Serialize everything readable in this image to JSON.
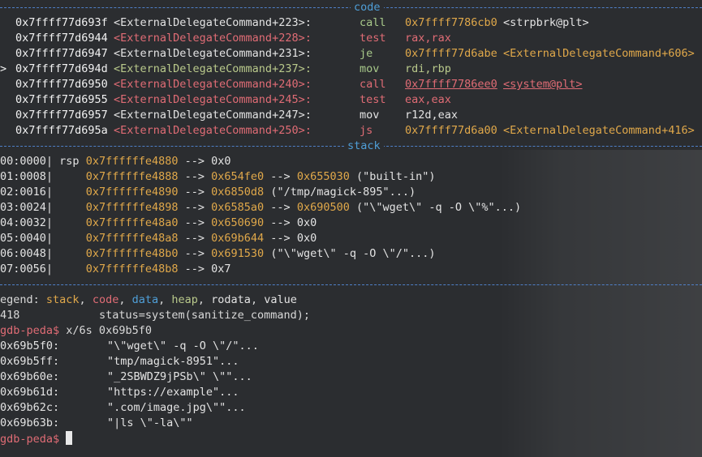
{
  "sections": {
    "code_label": "code",
    "stack_label": "stack"
  },
  "code": [
    {
      "marker": "",
      "addr": "0x7ffff77d693f",
      "sym": "<ExternalDelegateCommand+223>:",
      "mn": "call",
      "op": "0x7ffff7786cb0",
      "tgt": "<strpbrk@plt>",
      "style": "plain"
    },
    {
      "marker": "",
      "addr": "0x7ffff77d6944",
      "sym": "<ExternalDelegateCommand+228>:",
      "mn": "test",
      "op": "rax,rax",
      "tgt": "",
      "style": "hl"
    },
    {
      "marker": "",
      "addr": "0x7ffff77d6947",
      "sym": "<ExternalDelegateCommand+231>:",
      "mn": "je",
      "op": "0x7ffff77d6abe",
      "tgt": "<ExternalDelegateCommand+606>",
      "style": "plain"
    },
    {
      "marker": ">",
      "addr": "0x7ffff77d694d",
      "sym": "<ExternalDelegateCommand+237>:",
      "mn": "mov",
      "op": "rdi,rbp",
      "tgt": "",
      "style": "gr"
    },
    {
      "marker": "",
      "addr": "0x7ffff77d6950",
      "sym": "<ExternalDelegateCommand+240>:",
      "mn": "call",
      "op": "0x7ffff7786ee0",
      "tgt": "<system@plt>",
      "style": "red"
    },
    {
      "marker": "",
      "addr": "0x7ffff77d6955",
      "sym": "<ExternalDelegateCommand+245>:",
      "mn": "test",
      "op": "eax,eax",
      "tgt": "",
      "style": "hl"
    },
    {
      "marker": "",
      "addr": "0x7ffff77d6957",
      "sym": "<ExternalDelegateCommand+247>:",
      "mn": "mov",
      "op": "r12d,eax",
      "tgt": "",
      "style": "wh"
    },
    {
      "marker": "",
      "addr": "0x7ffff77d695a",
      "sym": "<ExternalDelegateCommand+250>:",
      "mn": "js",
      "op": "0x7ffff77d6a00",
      "tgt": "<ExternalDelegateCommand+416>",
      "style": "hl"
    }
  ],
  "stack": [
    {
      "idx": "00:0000|",
      "reg": "rsp",
      "addr": "0x7ffffffe4880",
      "chain": [
        {
          "t": "0x0",
          "y": false
        }
      ],
      "tail": ""
    },
    {
      "idx": "01:0008|",
      "reg": "",
      "addr": "0x7ffffffe4888",
      "chain": [
        {
          "t": "0x654fe0",
          "y": true
        },
        {
          "t": "0x655030",
          "y": true
        }
      ],
      "tail": "(\"built-in\")"
    },
    {
      "idx": "02:0016|",
      "reg": "",
      "addr": "0x7ffffffe4890",
      "chain": [
        {
          "t": "0x6850d8",
          "y": true
        }
      ],
      "tail": "(\"/tmp/magick-895\"...)"
    },
    {
      "idx": "03:0024|",
      "reg": "",
      "addr": "0x7ffffffe4898",
      "chain": [
        {
          "t": "0x6585a0",
          "y": true
        },
        {
          "t": "0x690500",
          "y": true
        }
      ],
      "tail": "(\"\\\"wget\\\" -q -O \\\"%\"...)"
    },
    {
      "idx": "04:0032|",
      "reg": "",
      "addr": "0x7ffffffe48a0",
      "chain": [
        {
          "t": "0x650690",
          "y": true
        },
        {
          "t": "0x0",
          "y": false
        }
      ],
      "tail": ""
    },
    {
      "idx": "05:0040|",
      "reg": "",
      "addr": "0x7ffffffe48a8",
      "chain": [
        {
          "t": "0x69b644",
          "y": true
        },
        {
          "t": "0x0",
          "y": false
        }
      ],
      "tail": ""
    },
    {
      "idx": "06:0048|",
      "reg": "",
      "addr": "0x7ffffffe48b0",
      "chain": [
        {
          "t": "0x691530",
          "y": true
        }
      ],
      "tail": "(\"\\\"wget\\\" -q -O \\\"/\"...)"
    },
    {
      "idx": "07:0056|",
      "reg": "",
      "addr": "0x7ffffffe48b8",
      "chain": [
        {
          "t": "0x7",
          "y": false
        }
      ],
      "tail": ""
    }
  ],
  "legend": {
    "prefix": "egend: ",
    "stack": "stack",
    "code": "code",
    "data": "data",
    "heap": "heap",
    "rodata": "rodata",
    "value": "value"
  },
  "source_line": {
    "num": "418",
    "text": "status=system(sanitize_command);"
  },
  "prompt": "gdb-peda$",
  "command": "x/6s 0x69b5f0",
  "memory": [
    {
      "addr": "0x69b5f0:",
      "str": "\"\\\"wget\\\" -q -O \\\"/\"..."
    },
    {
      "addr": "0x69b5ff:",
      "str": "\"tmp/magick-8951\"..."
    },
    {
      "addr": "0x69b60e:",
      "str": "\"_2SBWDZ9jPSb\\\" \\\"\"..."
    },
    {
      "addr": "0x69b61d:",
      "str": "\"https://example\"..."
    },
    {
      "addr": "0x69b62c:",
      "str": "\".com/image.jpg\\\"\"..."
    },
    {
      "addr": "0x69b63b:",
      "str": "\"|ls \\\"-la\\\"\""
    }
  ],
  "prompt2": "gdb-peda$"
}
